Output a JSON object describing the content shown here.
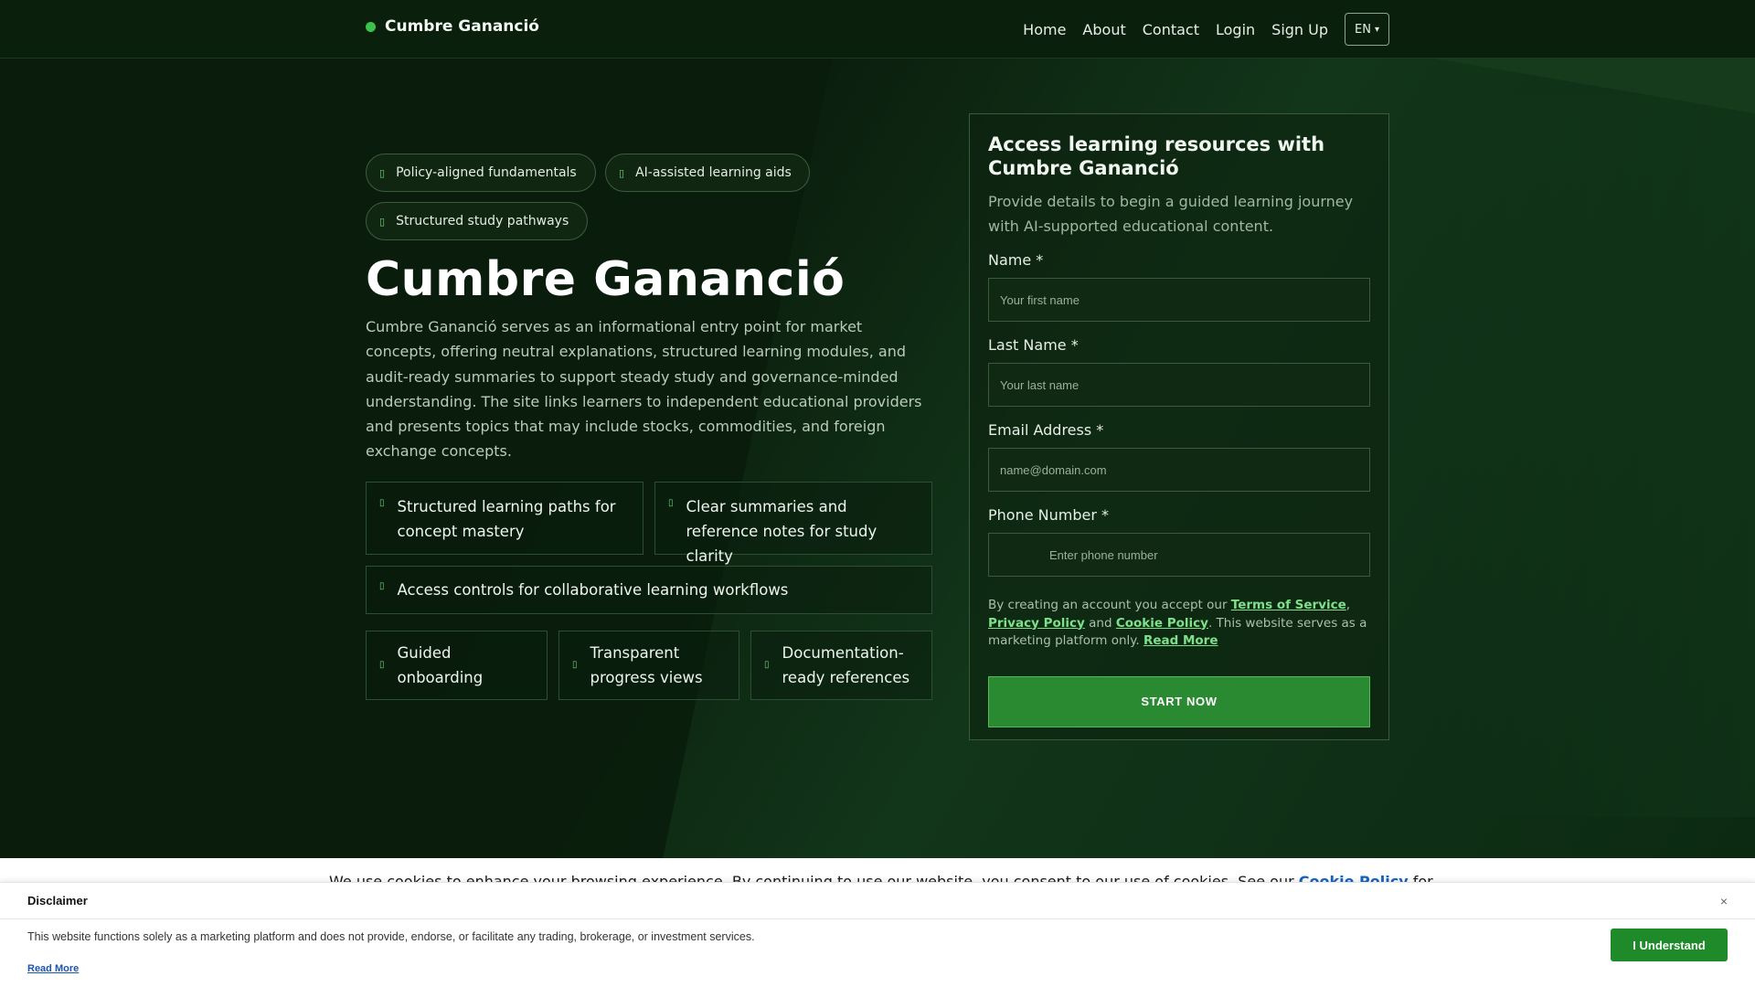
{
  "header": {
    "brand": "Cumbre Gananció",
    "nav": [
      "Home",
      "About",
      "Contact",
      "Login",
      "Sign Up"
    ],
    "language": "EN",
    "language_caret": "▾"
  },
  "hero": {
    "pills": [
      "Policy-aligned fundamentals",
      "AI-assisted learning aids",
      "Structured study pathways"
    ],
    "title": "Cumbre Gananció",
    "description": "Cumbre Gananció serves as an informational entry point for market concepts, offering neutral explanations, structured learning modules, and audit-ready summaries to support steady study and governance-minded understanding. The site links learners to independent educational providers and presents topics that may include stocks, commodities, and foreign exchange concepts.",
    "features_row1": [
      "Structured learning paths for concept mastery",
      "Clear summaries and reference notes for study clarity"
    ],
    "feature_wide": "Access controls for collaborative learning workflows",
    "features_row3": [
      "Guided onboarding",
      "Transparent progress views",
      "Documentation-ready references"
    ],
    "icon_glyph": "▯"
  },
  "form": {
    "title": "Access learning resources with Cumbre Gananció",
    "subtitle": "Provide details to begin a guided learning journey with AI-supported educational content.",
    "name_label": "Name *",
    "name_placeholder": "Your first name",
    "last_name_label": "Last Name *",
    "last_name_placeholder": "Your last name",
    "email_label": "Email Address *",
    "email_placeholder": "name@domain.com",
    "phone_label": "Phone Number *",
    "phone_placeholder": "Enter phone number",
    "consent_prefix": "By creating an account you accept our ",
    "terms": "Terms of Service",
    "comma": ",",
    "privacy": "Privacy Policy",
    "and": " and ",
    "cookie": "Cookie Policy",
    "consent_suffix": ". This website serves as a marketing platform only. ",
    "read_more": "Read More",
    "submit": "START NOW"
  },
  "cookie_banner": {
    "text": "We use cookies to enhance your browsing experience. By continuing to use our website, you consent to our use of cookies. See our ",
    "link": "Cookie Policy",
    "suffix": " for"
  },
  "disclaimer": {
    "title": "Disclaimer",
    "close": "×",
    "text": "This website functions solely as a marketing platform and does not provide, endorse, or facilitate any trading, brokerage, or investment services.",
    "read_more": "Read More",
    "button": "I Understand"
  }
}
